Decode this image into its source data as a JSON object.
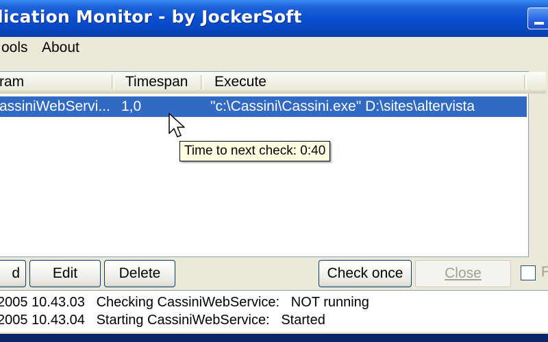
{
  "window": {
    "title": "plication Monitor - by JockerSoft"
  },
  "menu": {
    "items": [
      "ools",
      "About"
    ]
  },
  "list": {
    "columns": [
      "ram",
      "Timespan",
      "Execute"
    ],
    "rows": [
      {
        "program": "assiniWebServi...",
        "timespan": "1,0",
        "execute": "\"c:\\Cassini\\Cassini.exe\" D:\\sites\\altervista"
      }
    ]
  },
  "tooltip": {
    "text": "Time to next check: 0:40"
  },
  "buttons": {
    "add": "d",
    "edit": "Edit",
    "delete": "Delete",
    "check_once": "Check once",
    "close": "Close"
  },
  "checkbox": {
    "label": "F",
    "checked": false
  },
  "log": [
    {
      "date": "2005 10.43.03",
      "action": "Checking CassiniWebService:",
      "result": "NOT running"
    },
    {
      "date": "2005 10.43.04",
      "action": "Starting CassiniWebService:",
      "result": "Started"
    }
  ]
}
